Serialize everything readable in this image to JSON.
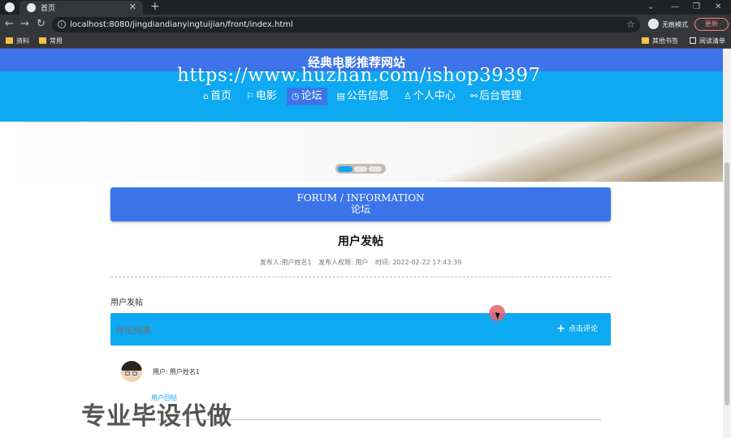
{
  "browser": {
    "tab_title": "首页",
    "tab_close": "✕",
    "new_tab": "+",
    "controls": {
      "chevron": "⌄",
      "minimize": "—",
      "restore": "❐",
      "close": "✕"
    },
    "nav": {
      "back": "←",
      "forward": "→",
      "reload": "↻"
    },
    "info": "i",
    "url": "localhost:8080/jingdiandianyingtuijian/front/index.html",
    "star": "☆",
    "incognito_label": "无痕模式",
    "update_label": "更新",
    "bookmarks": [
      "资料",
      "常用"
    ],
    "other_bookmarks": "其他书签",
    "reading_list": "阅读清单"
  },
  "site": {
    "title": "经典电影推荐网站",
    "watermark_url": "https://www.huzhan.com/ishop39397",
    "nav": [
      {
        "glyph": "⌂",
        "label": "首页"
      },
      {
        "glyph": "⚐",
        "label": "电影"
      },
      {
        "glyph": "◷",
        "label": "论坛",
        "active": true
      },
      {
        "glyph": "▤",
        "label": "公告信息"
      },
      {
        "glyph": "♙",
        "label": "个人中心"
      },
      {
        "glyph": "⚯",
        "label": "后台管理"
      }
    ]
  },
  "section": {
    "en": "FORUM / INFORMATION",
    "cn": "论坛"
  },
  "post": {
    "title": "用户发帖",
    "author": "发布人:用户姓名1",
    "role": "发布人权限: 用户",
    "time": "时间: 2022-02-22 17:43:39",
    "content": "用户发帖"
  },
  "comments": {
    "title": "评论列表",
    "add_label": "点击评论",
    "plus": "+",
    "items": [
      {
        "user_label": "用户:",
        "user_name": "用户姓名1",
        "content": "用户回帖"
      }
    ]
  },
  "overlay": "专业毕设代做",
  "colors": {
    "header": "#0da9f2",
    "accent": "#3c74ea"
  }
}
